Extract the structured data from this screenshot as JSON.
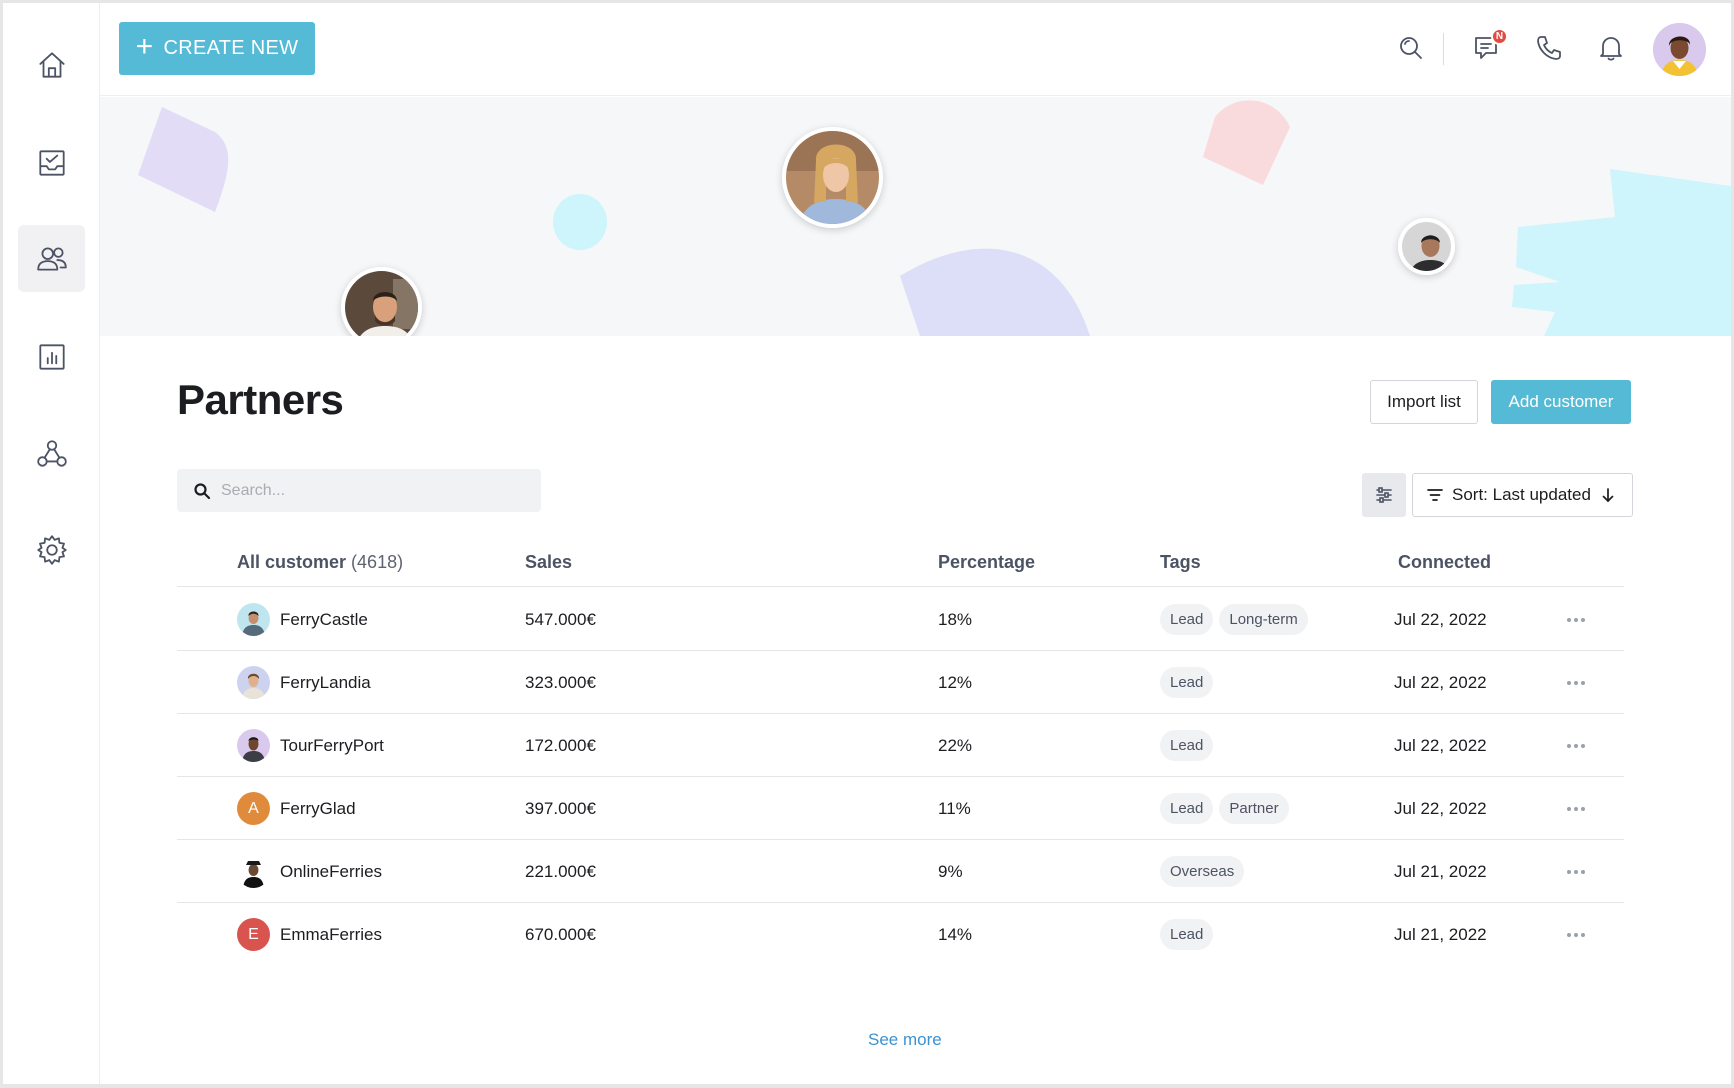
{
  "header": {
    "create_label": "CREATE NEW",
    "message_badge": "N"
  },
  "sidebar": {
    "items": [
      {
        "name": "home",
        "icon": "home-icon",
        "active": false
      },
      {
        "name": "inbox",
        "icon": "inbox-check-icon",
        "active": false
      },
      {
        "name": "customers",
        "icon": "users-icon",
        "active": true
      },
      {
        "name": "reports",
        "icon": "bar-chart-icon",
        "active": false
      },
      {
        "name": "integrations",
        "icon": "nodes-icon",
        "active": false
      },
      {
        "name": "settings",
        "icon": "gear-icon",
        "active": false
      }
    ]
  },
  "page": {
    "title": "Partners",
    "import_label": "Import list",
    "add_label": "Add customer",
    "search_placeholder": "Search...",
    "sort_label": "Sort: Last updated"
  },
  "table": {
    "headers": {
      "customer": "All customer",
      "customer_count": "(4618)",
      "sales": "Sales",
      "percentage": "Percentage",
      "tags": "Tags",
      "connected": "Connected"
    },
    "rows": [
      {
        "name": "FerryCastle",
        "sales": "547.000€",
        "percentage": "18%",
        "tags": [
          "Lead",
          "Long-term"
        ],
        "connected": "Jul 22, 2022",
        "avatar": "photo",
        "initial": ""
      },
      {
        "name": "FerryLandia",
        "sales": "323.000€",
        "percentage": "12%",
        "tags": [
          "Lead"
        ],
        "connected": "Jul 22, 2022",
        "avatar": "photo",
        "initial": ""
      },
      {
        "name": "TourFerryPort",
        "sales": "172.000€",
        "percentage": "22%",
        "tags": [
          "Lead"
        ],
        "connected": "Jul 22, 2022",
        "avatar": "photo",
        "initial": ""
      },
      {
        "name": "FerryGlad",
        "sales": "397.000€",
        "percentage": "11%",
        "tags": [
          "Lead",
          "Partner"
        ],
        "connected": "Jul 22, 2022",
        "avatar": "initial",
        "initial": "A"
      },
      {
        "name": "OnlineFerries",
        "sales": "221.000€",
        "percentage": "9%",
        "tags": [
          "Overseas"
        ],
        "connected": "Jul 21, 2022",
        "avatar": "photo",
        "initial": ""
      },
      {
        "name": "EmmaFerries",
        "sales": "670.000€",
        "percentage": "14%",
        "tags": [
          "Lead"
        ],
        "connected": "Jul 21, 2022",
        "avatar": "initial",
        "initial": "E"
      }
    ],
    "see_more": "See more"
  },
  "colors": {
    "accent": "#55bad6",
    "link": "#3b92d1",
    "badge": "#e14b42",
    "avatar_a": "#e08a3c",
    "avatar_e": "#d9534f"
  }
}
